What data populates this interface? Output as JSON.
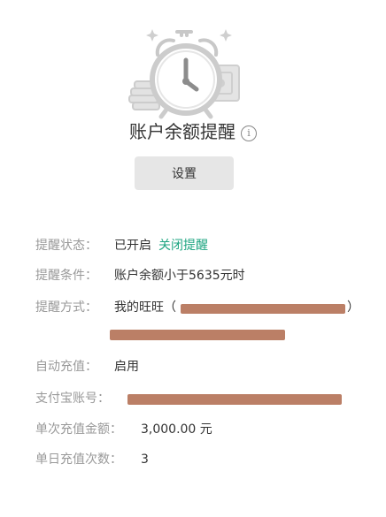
{
  "header": {
    "title": "账户余额提醒",
    "info_icon": "info-icon",
    "settings_label": "设置"
  },
  "details": {
    "status": {
      "label": "提醒状态：",
      "value": "已开启",
      "action": "关闭提醒"
    },
    "condition": {
      "label": "提醒条件：",
      "value": "账户余额小于5635元时"
    },
    "method": {
      "label": "提醒方式：",
      "value": "我的旺旺（",
      "close_paren": "）"
    },
    "auto_recharge": {
      "label": "自动充值：",
      "value": "启用"
    },
    "alipay": {
      "label": "支付宝账号："
    },
    "single_amount": {
      "label": "单次充值金额：",
      "value": "3,000.00 元"
    },
    "daily_count": {
      "label": "单日充值次数：",
      "value": "3"
    }
  },
  "colors": {
    "accent": "#1ea581",
    "redaction": "#bb7f66",
    "button_bg": "#e6e6e6"
  }
}
